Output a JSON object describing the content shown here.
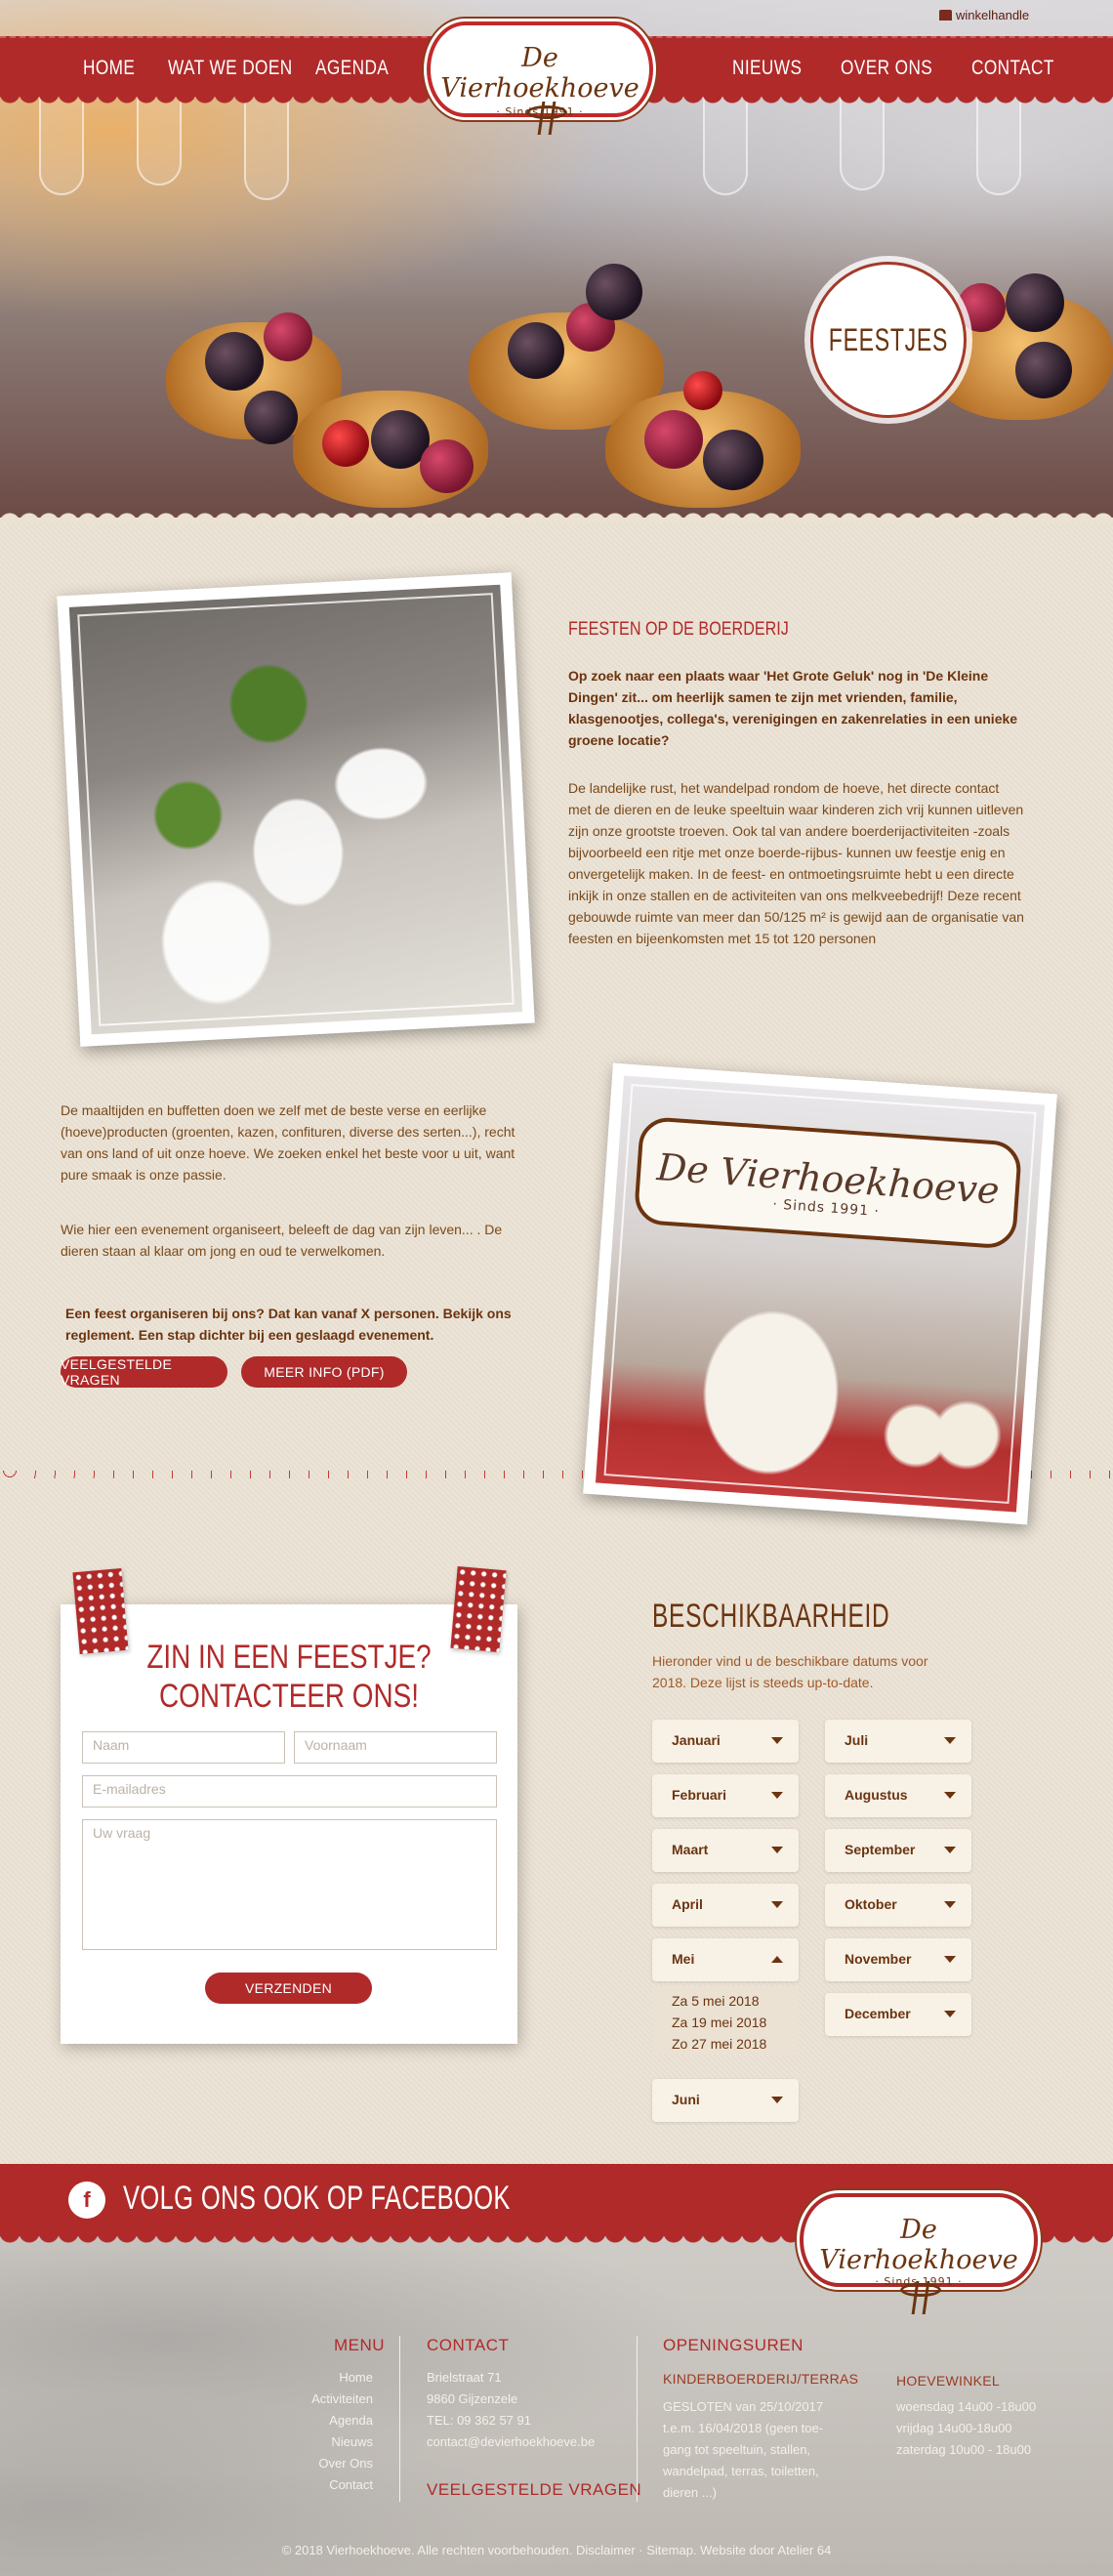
{
  "header": {
    "shop_link": "winkelhandle",
    "nav_left": [
      "HOME",
      "WAT WE DOEN",
      "AGENDA"
    ],
    "nav_right": [
      "NIEUWS",
      "OVER ONS",
      "CONTACT"
    ],
    "logo_name": "De Vierhoekhoeve",
    "logo_since": "· Sinds 1991 ·"
  },
  "hero": {
    "badge": "FEESTJES"
  },
  "section1": {
    "title": "FEESTEN OP DE BOERDERIJ",
    "intro": "Op zoek naar een plaats waar 'Het Grote Geluk' nog in 'De Kleine Dingen' zit... om heerlijk samen te zijn met vrienden, familie, klasgenootjes, collega's, verenigingen en zakenrelaties in een unieke groene locatie?",
    "body": "De landelijke rust, het wandelpad rondom de hoeve, het directe contact met de dieren en de leuke speeltuin waar kinderen zich vrij kunnen uitleven zijn onze grootste troeven. Ook tal van andere boerderijactiviteiten -zoals bijvoorbeeld een ritje met onze boerde-rijbus- kunnen uw feestje enig en onvergetelijk maken. In de feest- en ontmoetingsruimte hebt u een directe inkijk in onze stallen en de activiteiten van ons melkveebedrijf! Deze recent gebouwde ruimte van meer dan 50/125 m² is gewijd aan de organisatie van feesten en bijeenkomsten met 15 tot 120 personen"
  },
  "section2": {
    "p1": "De maaltijden en buffetten doen we zelf met de beste verse en eerlijke (hoeve)producten (groenten, kazen, confituren, diverse des serten...), recht van ons land of uit onze hoeve. We zoeken enkel het beste voor u uit, want pure smaak is onze passie.",
    "p2": "Wie hier een evenement organiseert, beleeft de dag van zijn leven... . De dieren staan al klaar om jong en oud te verwelkomen.",
    "cta": "Een feest organiseren bij ons? Dat kan vanaf X personen. Bekijk ons reglement. Een stap dichter bij een geslaagd evenement.",
    "btn_faq": "VEELGESTELDE VRAGEN",
    "btn_info": "MEER INFO (PDF)",
    "sign_name": "De Vierhoekhoeve",
    "sign_since": "· Sinds 1991 ·"
  },
  "contact": {
    "title_line1": "ZIN IN EEN FEESTJE?",
    "title_line2": "CONTACTEER ONS!",
    "ph_name": "Naam",
    "ph_firstname": "Voornaam",
    "ph_email": "E-mailadres",
    "ph_question": "Uw vraag",
    "submit": "VERZENDEN"
  },
  "availability": {
    "title": "BESCHIKBAARHEID",
    "subtitle": "Hieronder vind u de beschikbare datums voor 2018. Deze lijst is steeds up-to-date.",
    "left_months": [
      "Januari",
      "Februari",
      "Maart",
      "April",
      "Mei",
      "Juni"
    ],
    "right_months": [
      "Juli",
      "Augustus",
      "September",
      "Oktober",
      "November",
      "December"
    ],
    "open_month": "Mei",
    "open_dates": [
      "Za 5 mei 2018",
      "Za 19 mei 2018",
      "Zo 27 mei 2018"
    ]
  },
  "footer": {
    "facebook": "VOLG ONS OOK OP FACEBOOK",
    "logo_name": "De Vierhoekhoeve",
    "logo_since": "· Sinds 1991 ·",
    "menu_title": "MENU",
    "menu": [
      "Home",
      "Activiteiten",
      "Agenda",
      "Nieuws",
      "Over Ons",
      "Contact"
    ],
    "contact_title": "CONTACT",
    "contact": [
      "Brielstraat 71",
      "9860 Gijzenzele",
      "TEL: 09 362 57 91",
      "contact@devierhoekhoeve.be"
    ],
    "faq_title": "VEELGESTELDE VRAGEN",
    "hours_title": "OPENINGSUREN",
    "kinder_title": "KINDERBOERDERIJ/TERRAS",
    "kinder": [
      "GESLOTEN van 25/10/2017",
      "t.e.m. 16/04/2018 (geen toe-",
      "gang tot speeltuin, stallen,",
      "wandelpad, terras, toiletten,",
      "dieren ...)"
    ],
    "shop_title": "HOEVEWINKEL",
    "shop": [
      "woensdag 14u00 -18u00",
      "vrijdag 14u00-18u00",
      "zaterdag 10u00 - 18u00"
    ],
    "copyright": "© 2018 Vierhoekhoeve. Alle rechten voorbehouden. Disclaimer · Sitemap. Website door Atelier 64"
  }
}
